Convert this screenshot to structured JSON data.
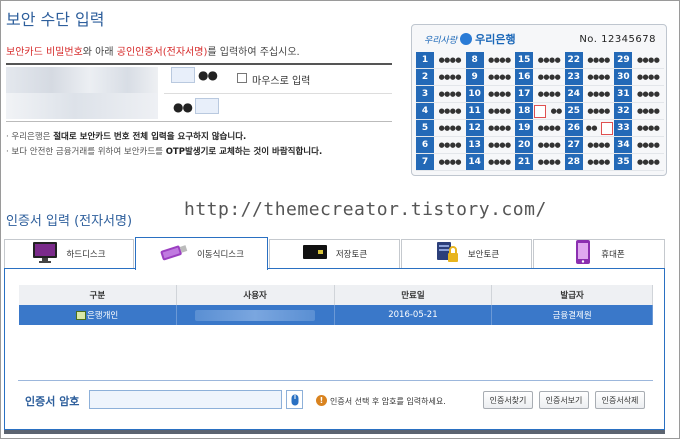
{
  "security_input": {
    "title": "보안 수단 입력",
    "instruction_part1": "보안카드 비밀번호",
    "instruction_part2": "와 아래 ",
    "instruction_part3": "공인인증서(전자서명)",
    "instruction_part4": "를 입력하여 주십시오.",
    "masked_1": "●●",
    "masked_2": "●●",
    "mouse_input_label": "마우스로 입력",
    "notes": [
      {
        "prefix": "· 우리은행은 ",
        "bold": "절대로 보안카드 번호 전체 입력을 요구하지 않습니다.",
        "suffix": ""
      },
      {
        "prefix": "· 보다 안전한 금융거래를 위하여 보안카드를 ",
        "bold": "OTP발생기로 교체하는 것이 바람직합니다.",
        "suffix": ""
      }
    ]
  },
  "security_card": {
    "brand_script": "우리사랑",
    "brand_name": "우리은행",
    "number": "No. 12345678",
    "rows": [
      [
        1,
        8,
        15,
        22,
        29
      ],
      [
        2,
        9,
        16,
        23,
        30
      ],
      [
        3,
        10,
        17,
        24,
        31
      ],
      [
        4,
        11,
        18,
        25,
        32
      ],
      [
        5,
        12,
        19,
        26,
        33
      ],
      [
        6,
        13,
        20,
        27,
        34
      ],
      [
        7,
        14,
        21,
        28,
        35
      ]
    ],
    "dots": "●●●●",
    "partial_dots": "●●",
    "highlight_colors": {
      "border": "#e05050",
      "number_bg": "#2369b7"
    }
  },
  "watermark": "http://themecreator.tistory.com/",
  "cert_section": {
    "title": "인증서 입력 (전자서명)",
    "tabs": [
      {
        "label": "하드디스크",
        "icon": "monitor-icon"
      },
      {
        "label": "이동식디스크",
        "icon": "usb-drive-icon"
      },
      {
        "label": "저장토큰",
        "icon": "token-icon"
      },
      {
        "label": "보안토큰",
        "icon": "secure-token-icon"
      },
      {
        "label": "휴대폰",
        "icon": "phone-icon"
      }
    ],
    "active_tab": "이동식디스크",
    "table": {
      "headers": [
        "구분",
        "사용자",
        "만료일",
        "발급자"
      ],
      "rows": [
        {
          "type": "은행개인",
          "user": "",
          "expiry": "2016-05-21",
          "issuer": "금융결제원"
        }
      ]
    },
    "password_label": "인증서 암호",
    "warning": "인증서 선택 후 암호를 입력하세요.",
    "buttons": [
      "인증서찾기",
      "인증서보기",
      "인증서삭제"
    ]
  }
}
